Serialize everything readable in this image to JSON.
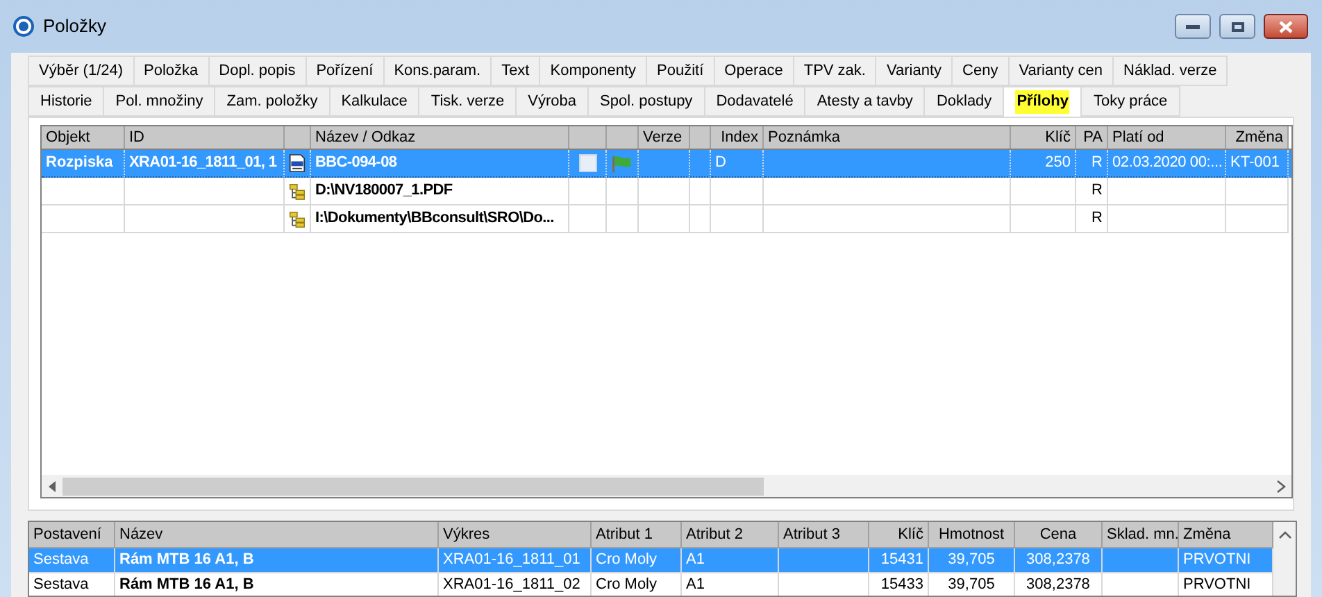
{
  "window": {
    "title": "Položky"
  },
  "tab_rows": [
    {
      "tabs": [
        {
          "label": "Výběr (1/24)",
          "selected": false
        },
        {
          "label": "Položka",
          "selected": false
        },
        {
          "label": "Dopl. popis",
          "selected": false
        },
        {
          "label": "Pořízení",
          "selected": false
        },
        {
          "label": "Kons.param.",
          "selected": false
        },
        {
          "label": "Text",
          "selected": false
        },
        {
          "label": "Komponenty",
          "selected": false
        },
        {
          "label": "Použití",
          "selected": false
        },
        {
          "label": "Operace",
          "selected": false
        },
        {
          "label": "TPV zak.",
          "selected": false
        },
        {
          "label": "Varianty",
          "selected": false
        },
        {
          "label": "Ceny",
          "selected": false
        },
        {
          "label": "Varianty cen",
          "selected": false
        },
        {
          "label": "Náklad. verze",
          "selected": false
        }
      ]
    },
    {
      "tabs": [
        {
          "label": "Historie",
          "selected": false
        },
        {
          "label": "Pol. množiny",
          "selected": false
        },
        {
          "label": "Zam. položky",
          "selected": false
        },
        {
          "label": "Kalkulace",
          "selected": false
        },
        {
          "label": "Tisk. verze",
          "selected": false
        },
        {
          "label": "Výroba",
          "selected": false
        },
        {
          "label": "Spol. postupy",
          "selected": false
        },
        {
          "label": "Dodavatelé",
          "selected": false
        },
        {
          "label": "Atesty a tavby",
          "selected": false
        },
        {
          "label": "Doklady",
          "selected": false
        },
        {
          "label": "Přílohy",
          "selected": true
        },
        {
          "label": "Toky práce",
          "selected": false
        }
      ]
    }
  ],
  "attachments": {
    "columns": {
      "objekt": "Objekt",
      "id": "ID",
      "name": "Název / Odkaz",
      "verze": "Verze",
      "index": "Index",
      "poznamka": "Poznámka",
      "klic": "Klíč",
      "pa": "PA",
      "plati_od": "Platí od",
      "zmena": "Změna"
    },
    "rows": [
      {
        "kind": "item",
        "selected": true,
        "objekt": "Rozpiska",
        "id": "XRA01-16_1811_01, 1",
        "name": "BBC-094-08",
        "index": "D",
        "klic": "250",
        "pa": "R",
        "plati_od": "02.03.2020 00:...",
        "zmena": "KT-001"
      },
      {
        "kind": "link",
        "selected": false,
        "name": "D:\\NV180007_1.PDF",
        "pa": "R"
      },
      {
        "kind": "link",
        "selected": false,
        "name": "I:\\Dokumenty\\BBconsult\\SRO\\Do...",
        "pa": "R"
      }
    ]
  },
  "items": {
    "columns": [
      "Postavení",
      "Název",
      "Výkres",
      "Atribut 1",
      "Atribut 2",
      "Atribut 3",
      "Klíč",
      "Hmotnost",
      "Cena",
      "Sklad. mn.",
      "Změna"
    ],
    "rows": [
      {
        "selected": true,
        "cells": [
          "Sestava",
          "Rám MTB 16 A1, B",
          "XRA01-16_1811_01",
          "Cro Moly",
          "A1",
          "",
          "15431",
          "39,705",
          "308,2378",
          "",
          "PRVOTNI"
        ]
      },
      {
        "selected": false,
        "cells": [
          "Sestava",
          "Rám MTB 16 A1, B",
          "XRA01-16_1811_02",
          "Cro Moly",
          "A1",
          "",
          "15433",
          "39,705",
          "308,2378",
          "",
          "PRVOTNI"
        ]
      }
    ]
  }
}
